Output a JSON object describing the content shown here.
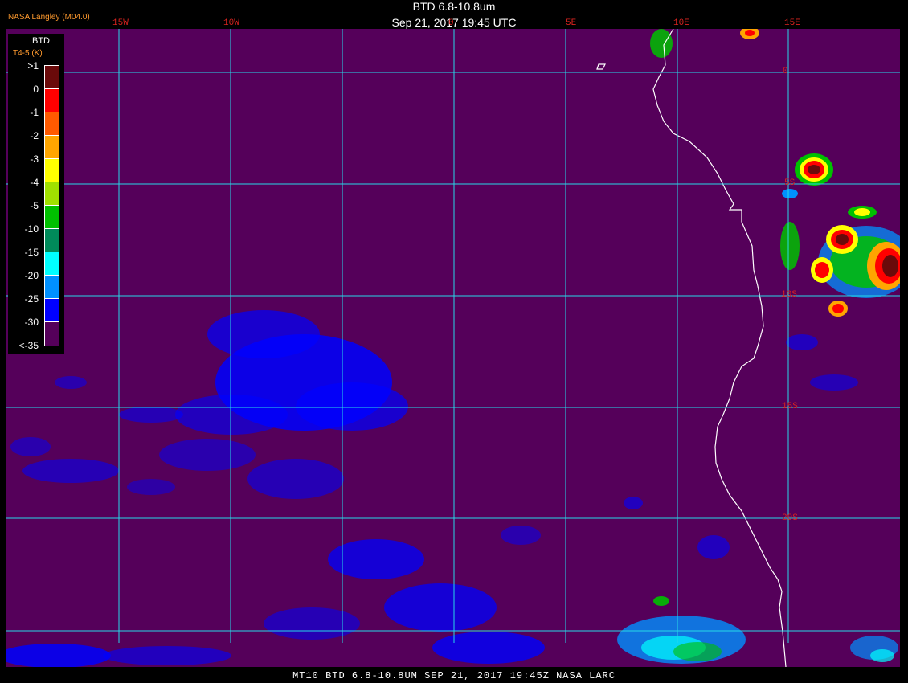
{
  "header": {
    "title": "BTD 6.8-10.8um",
    "timestamp": "Sep 21, 2017 19:45 UTC",
    "credit": "NASA Langley (M04.0)"
  },
  "grid": {
    "lon_labels": [
      "15W",
      "10W",
      "0",
      "5E",
      "10E",
      "15E"
    ],
    "lat_labels": [
      "0",
      "5S",
      "10S",
      "15S",
      "20S"
    ]
  },
  "legend": {
    "title": "BTD",
    "subtitle": "T4-5 (K)",
    "ticks": [
      ">1",
      "0",
      "-1",
      "-2",
      "-3",
      "-4",
      "-5",
      "-10",
      "-15",
      "-20",
      "-25",
      "-30",
      "<-35"
    ],
    "colors": [
      "#6a0a0a",
      "#ff0000",
      "#ff5a00",
      "#ffa500",
      "#ffff00",
      "#a0e000",
      "#00c000",
      "#008a5a",
      "#00ffff",
      "#0090ff",
      "#0000ff",
      "#55005a"
    ]
  },
  "footer": "MT10  BTD 6.8-10.8UM  SEP 21, 2017 19:45Z  NASA LARC",
  "colors": {
    "background": "#55005a",
    "grid": "#27d8e8",
    "coast": "#ffffff",
    "label": "#d8231f",
    "credit": "#ff9a2e"
  }
}
